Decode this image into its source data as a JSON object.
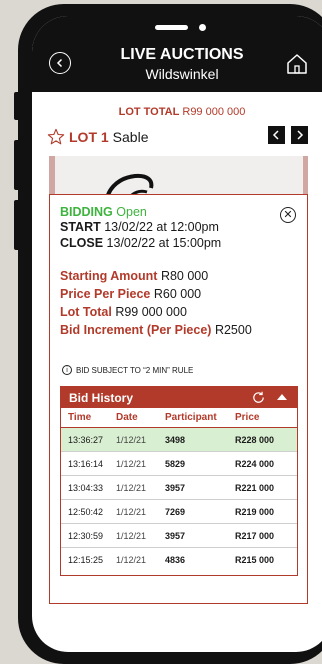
{
  "header": {
    "title": "LIVE AUCTIONS",
    "subtitle": "Wildswinkel"
  },
  "lot_total": {
    "label": "LOT TOTAL",
    "value": "R99 000 000"
  },
  "lot": {
    "label": "LOT 1",
    "name": "Sable",
    "prev_icon": "<",
    "next_icon": ">"
  },
  "bidding": {
    "label": "BIDDING",
    "status": "Open",
    "start_label": "START",
    "start_value": "13/02/22 at 12:00pm",
    "close_label": "CLOSE",
    "close_value": "13/02/22 at 15:00pm"
  },
  "amounts": {
    "starting_label": "Starting Amount",
    "starting_value": "R80 000",
    "per_piece_label": "Price Per Piece",
    "per_piece_value": "R60 000",
    "lot_total_label": "Lot Total",
    "lot_total_value": "R99 000 000",
    "increment_label": "Bid Increment (Per Piece)",
    "increment_value": "R2500"
  },
  "note": "BID SUBJECT TO “2 MIN” RULE",
  "bid_history": {
    "title": "Bid History",
    "columns": [
      "Time",
      "Date",
      "Participant",
      "Price"
    ],
    "rows": [
      {
        "time": "13:36:27",
        "date": "1/12/21",
        "participant": "3498",
        "price": "R228 000"
      },
      {
        "time": "13:16:14",
        "date": "1/12/21",
        "participant": "5829",
        "price": "R224 000"
      },
      {
        "time": "13:04:33",
        "date": "1/12/21",
        "participant": "3957",
        "price": "R221 000"
      },
      {
        "time": "12:50:42",
        "date": "1/12/21",
        "participant": "7269",
        "price": "R219 000"
      },
      {
        "time": "12:30:59",
        "date": "1/12/21",
        "participant": "3957",
        "price": "R217 000"
      },
      {
        "time": "12:15:25",
        "date": "1/12/21",
        "participant": "4836",
        "price": "R215 000"
      }
    ]
  },
  "colors": {
    "accent": "#b23a2a",
    "open_green": "#3eb33e",
    "highlight_row": "#d9efd2"
  },
  "icons": {
    "back": "back-arrow-icon",
    "home": "home-icon",
    "star": "star-outline-icon",
    "info": "info-icon",
    "close": "close-icon",
    "refresh": "refresh-icon",
    "collapse": "chevron-up-icon"
  }
}
